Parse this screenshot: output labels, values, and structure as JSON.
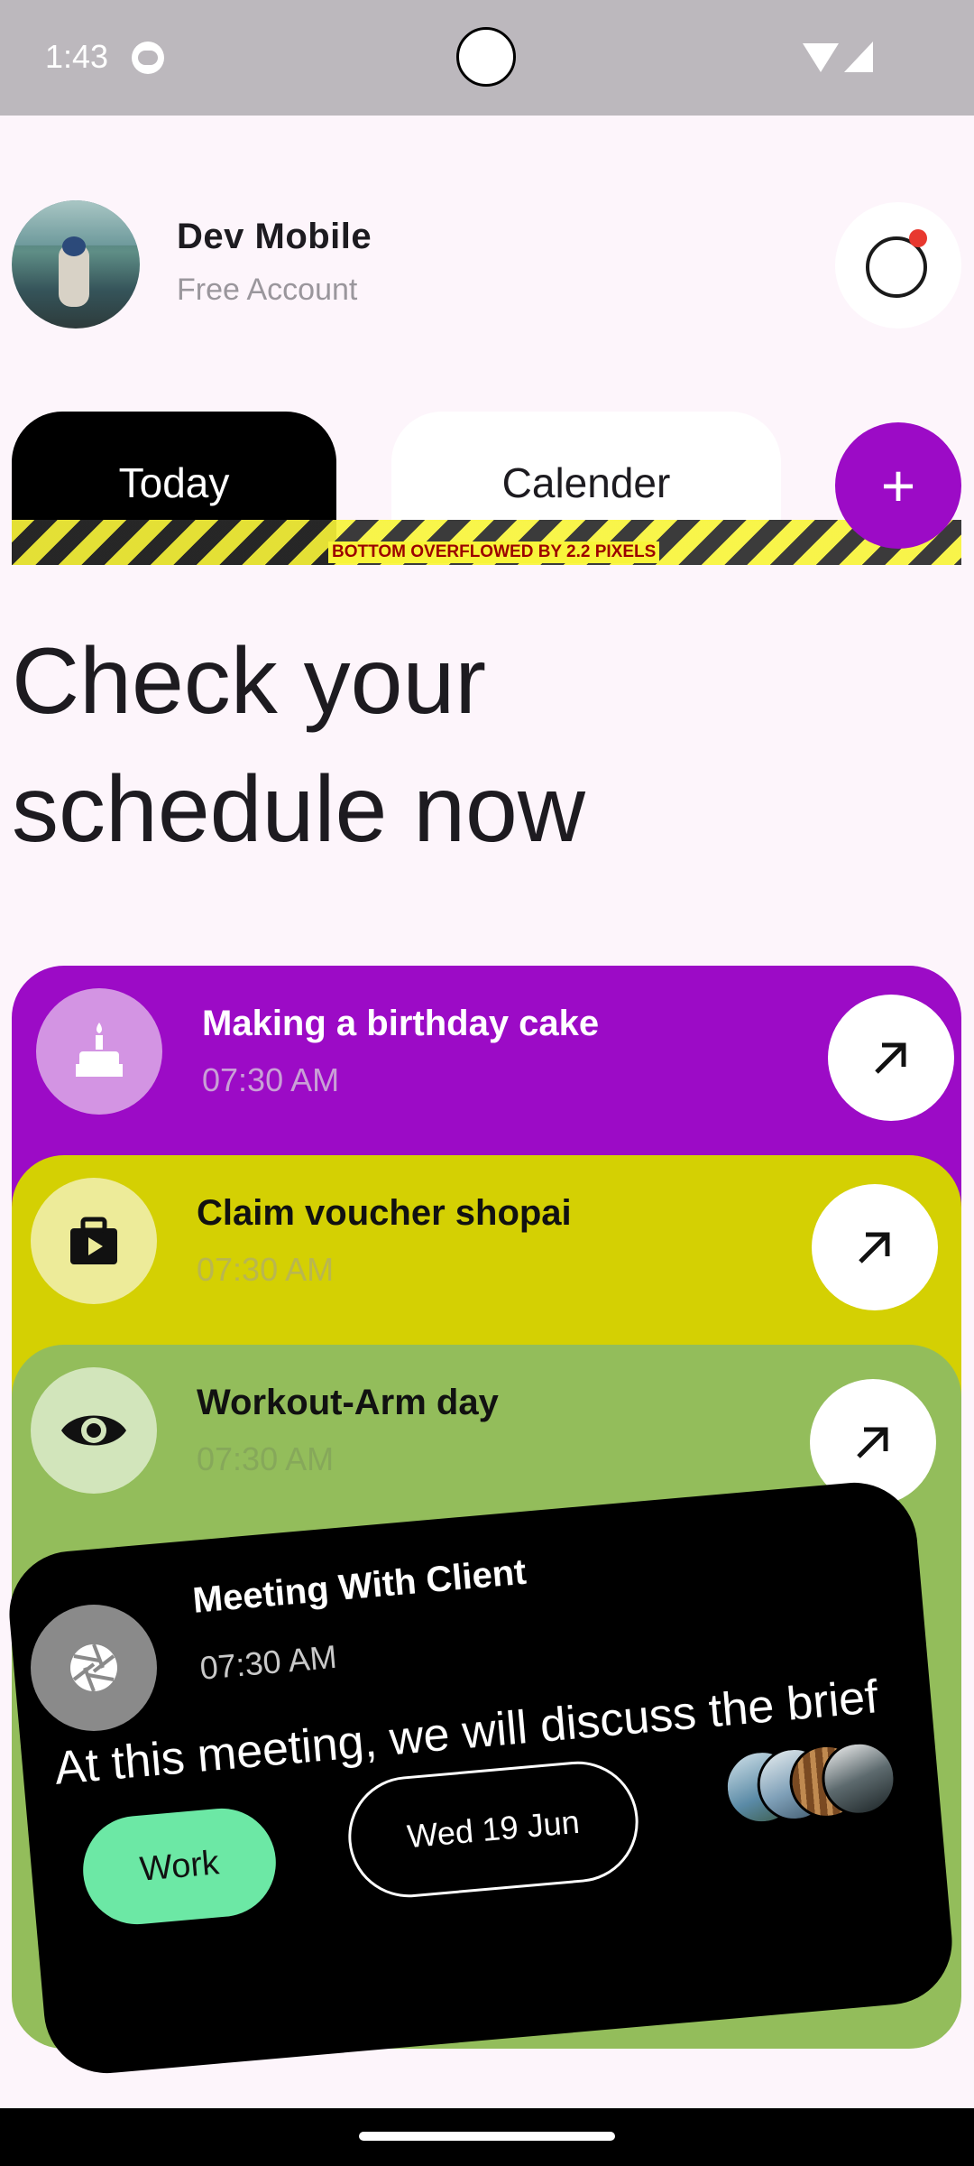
{
  "status_bar": {
    "time": "1:43"
  },
  "profile": {
    "name": "Dev Mobile",
    "subtitle": "Free Account"
  },
  "tabs": [
    {
      "label": "Today",
      "active": true
    },
    {
      "label": "Calender",
      "active": false
    }
  ],
  "add_button": {
    "label": "+"
  },
  "overflow_warning": "BOTTOM OVERFLOWED BY 2.2 PIXELS",
  "heading": "Check your schedule now",
  "tasks": [
    {
      "title": "Making a birthday cake",
      "time": "07:30 AM",
      "icon": "cake-icon",
      "color": "#9c0bc6"
    },
    {
      "title": "Claim voucher shopai",
      "time": "07:30 AM",
      "icon": "briefcase-icon",
      "color": "#d4d003"
    },
    {
      "title": "Workout-Arm day",
      "time": "07:30 AM",
      "icon": "eye-icon",
      "color": "#93bd5b"
    }
  ],
  "meeting": {
    "title": "Meeting With Client",
    "time": "07:30 AM",
    "description": "At this meeting, we will discuss the brief",
    "tag": "Work",
    "date": "Wed 19 Jun",
    "icon": "aperture-icon"
  },
  "colors": {
    "accent": "#9c0bc6",
    "tag": "#6ce8a5"
  }
}
